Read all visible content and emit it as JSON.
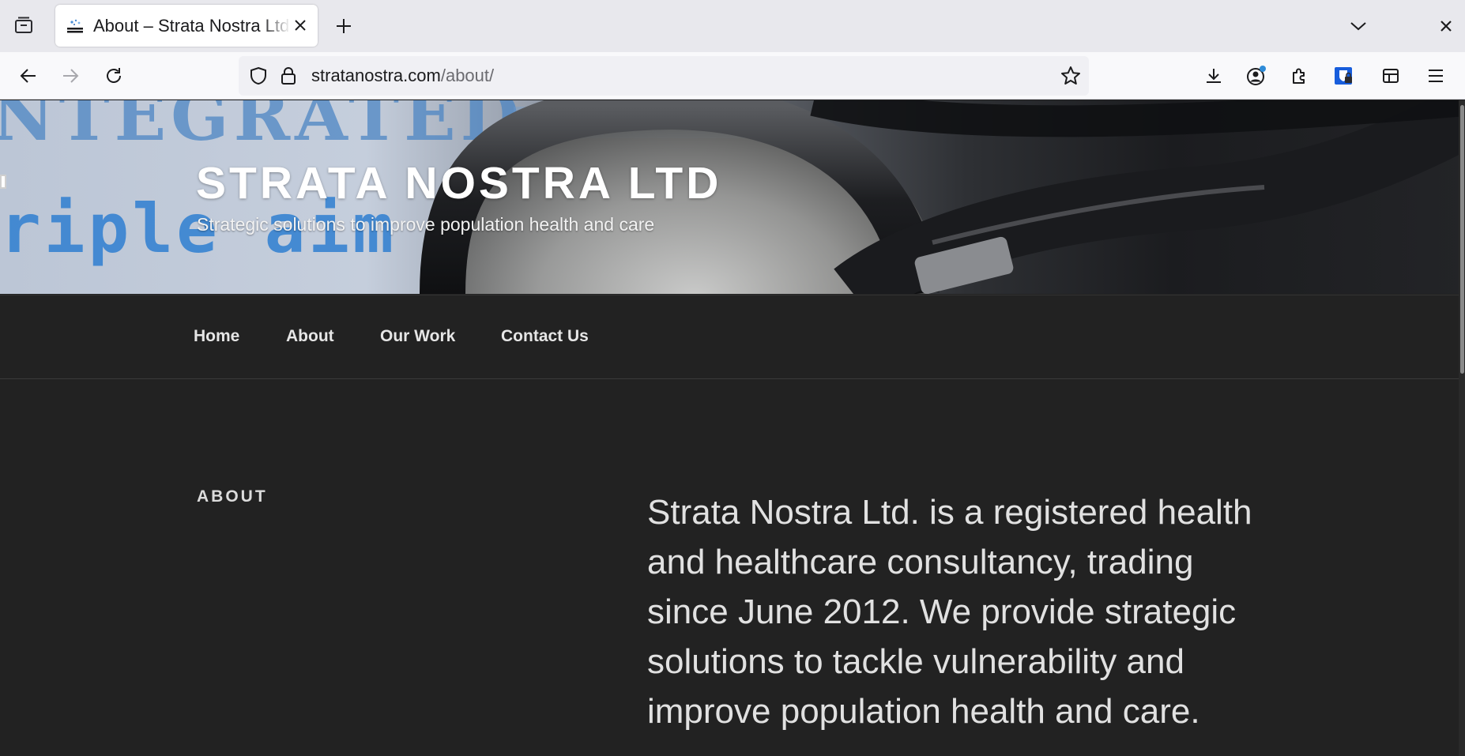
{
  "browser": {
    "tab": {
      "title": "About – Strata Nostra Ltd",
      "favicon": "strata-nostra-logo"
    },
    "url": {
      "host": "stratanostra.com",
      "path": "/about/"
    },
    "icons": {
      "tab_list": "tab-list-icon",
      "new_tab": "plus-icon",
      "tab_dropdown": "chevron-down-icon",
      "window_close": "close-icon",
      "back": "back-arrow-icon",
      "forward": "forward-arrow-icon",
      "reload": "reload-icon",
      "shield": "shield-icon",
      "lock": "lock-icon",
      "bookmark": "star-icon",
      "downloads": "download-icon",
      "account": "account-icon",
      "extensions": "puzzle-icon",
      "password_manager": "bitwarden-icon",
      "sidebar": "sidebar-icon",
      "menu": "hamburger-icon"
    }
  },
  "site": {
    "title": "Strata Nostra Ltd",
    "tagline": "Strategic solutions to improve population health and care",
    "header_image_text": {
      "line1": "NTEGRATED",
      "line2": "riple aim"
    },
    "menu": [
      {
        "label": "Home"
      },
      {
        "label": "About"
      },
      {
        "label": "Our Work"
      },
      {
        "label": "Contact Us"
      }
    ]
  },
  "main": {
    "heading": "About",
    "body": "Strata Nostra Ltd. is a registered health and healthcare consultancy, trading since June 2012.   We provide strategic solutions to tackle vulnerability and improve population health and care."
  },
  "colors": {
    "page_bg": "#222222",
    "text": "#e1e1e1",
    "tab_strip_bg": "#e8e8ed",
    "nav_bg": "#f9f9fb",
    "urlbar_bg": "#f0f0f4",
    "bitwarden_blue": "#175ddc"
  }
}
